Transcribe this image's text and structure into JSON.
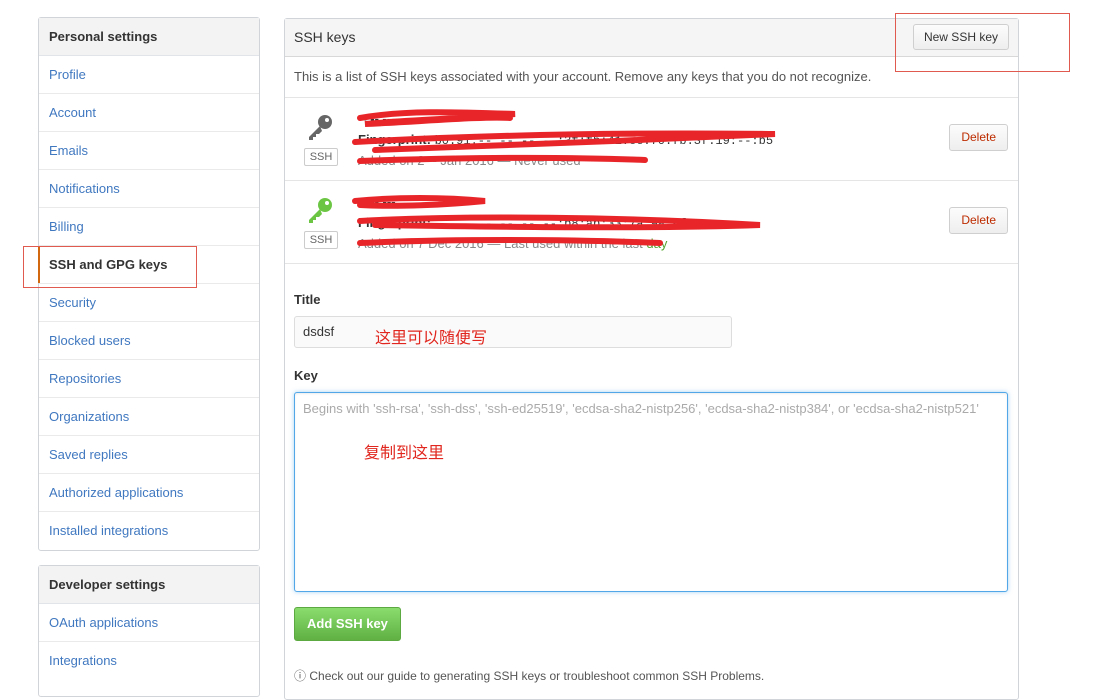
{
  "sidebar": {
    "personal_heading": "Personal settings",
    "items": [
      "Profile",
      "Account",
      "Emails",
      "Notifications",
      "Billing",
      "SSH and GPG keys",
      "Security",
      "Blocked users",
      "Repositories",
      "Organizations",
      "Saved replies",
      "Authorized applications",
      "Installed integrations"
    ],
    "selected": "SSH and GPG keys",
    "developer_heading": "Developer settings",
    "developer_items": [
      "OAuth applications",
      "Integrations"
    ]
  },
  "main": {
    "title": "SSH keys",
    "new_button": "New SSH key",
    "intro": "This is a list of SSH keys associated with your account. Remove any keys that you do not recognize.",
    "keys": [
      {
        "icon": "key-icon",
        "icon_color": "#666666",
        "badge": "SSH",
        "name": "-- -- ---",
        "fingerprint_label": "Fingerprint:",
        "fingerprint": "b0:91:-- -- -- --:3f:fb:41:ee:70:fb:3f:19:--:b5",
        "added": "Added on 2 -- Jan 2016 — Never used",
        "delete_label": "Delete"
      },
      {
        "icon": "key-icon",
        "icon_color": "#6cc644",
        "badge": "SSH",
        "name": "-- -- ---",
        "fingerprint_label": "Fingerprint:",
        "fingerprint": "-- -- -- -- -- --:b8:ab:33:7a:9a:af",
        "added": "Added on 7 Dec 2016 — Last used within the last",
        "added_suffix": "day",
        "delete_label": "Delete"
      }
    ],
    "form": {
      "title_label": "Title",
      "title_value": "dsdsf",
      "title_note": "这里可以随便写",
      "key_label": "Key",
      "key_placeholder": "Begins with 'ssh-rsa', 'ssh-dss', 'ssh-ed25519', 'ecdsa-sha2-nistp256', 'ecdsa-sha2-nistp384', or 'ecdsa-sha2-nistp521'",
      "key_note": "复制到这里",
      "add_button": "Add SSH key"
    },
    "footer_text": "Check out our guide to generating SSH keys or troubleshoot common SSH Problems."
  },
  "colors": {
    "link": "#4078c0",
    "selected_marker": "#d26911",
    "annotation_red": "#e0261e",
    "add_button_green": "#60b044",
    "delete_text": "#bd2c00"
  }
}
